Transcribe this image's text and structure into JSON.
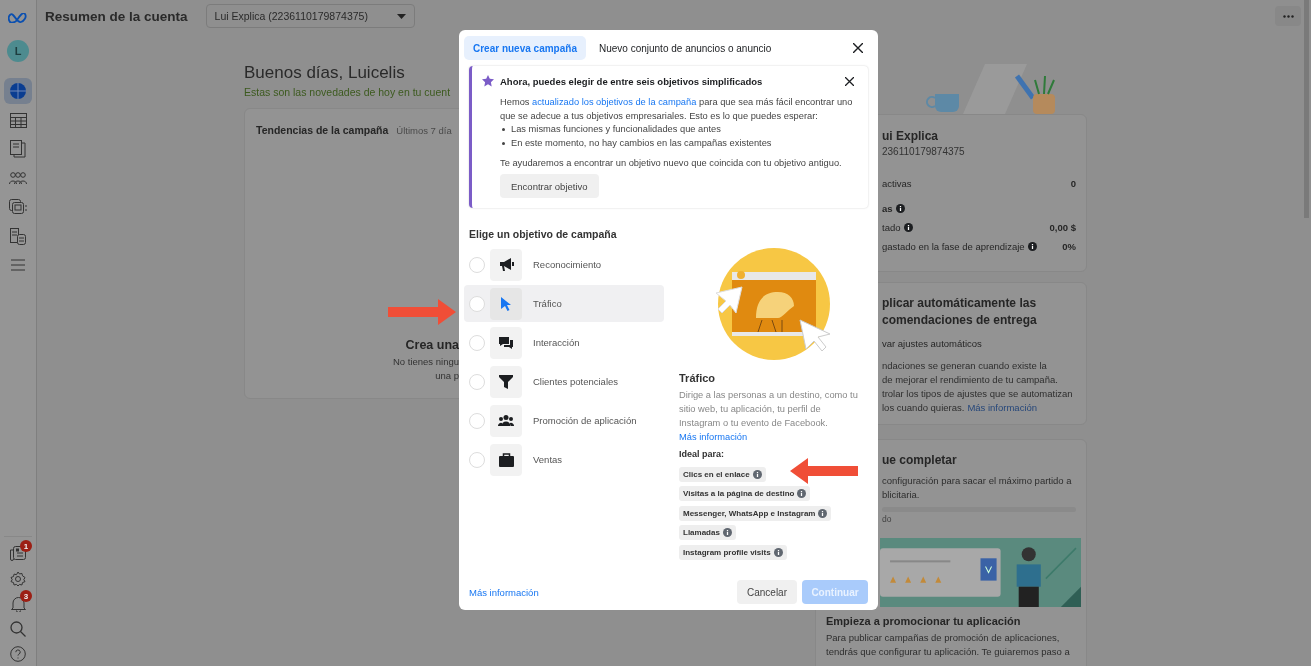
{
  "sidebar": {
    "avatar": {
      "initial": "L"
    },
    "items": [
      {
        "kind": "overview",
        "selected": true
      },
      {
        "kind": "table",
        "selected": false
      },
      {
        "kind": "pages",
        "selected": false
      },
      {
        "kind": "audiences",
        "selected": false
      },
      {
        "kind": "catalog",
        "selected": false
      },
      {
        "kind": "billing",
        "selected": false
      },
      {
        "kind": "menu",
        "selected": false
      }
    ],
    "bottom_items": [
      {
        "kind": "news",
        "badge": "1"
      },
      {
        "kind": "settings"
      },
      {
        "kind": "notifications",
        "badge": "3"
      },
      {
        "kind": "search"
      },
      {
        "kind": "help"
      }
    ]
  },
  "top_bar": {
    "title": "Resumen de la cuenta",
    "account_select": {
      "value": "Lui Explica (2236110179874375)"
    }
  },
  "greeting": {
    "title": "Buenos días, Luicelis",
    "subtitle": "Estas son las novedades de hoy en tu cuent"
  },
  "trends_card": {
    "title": "Tendencias de la campaña",
    "period": "Últimos 7 día",
    "empty_title": "Crea una",
    "empty_lines": [
      "No tienes ningu",
      "una p"
    ]
  },
  "account_card": {
    "name": "ui Explica",
    "id": "236110179874375",
    "rows": [
      {
        "kind": "stat",
        "label": "activas",
        "value": "0",
        "info": false
      },
      {
        "kind": "heading",
        "label": "as",
        "info": true
      },
      {
        "kind": "stat",
        "label": "tado",
        "value": "0,00 $",
        "info": true
      },
      {
        "kind": "stat",
        "label": "gastado en la fase de aprendizaje",
        "value": "0%",
        "info": true
      }
    ]
  },
  "recommendations_card": {
    "title_lines": [
      "plicar automáticamente las",
      "comendaciones de entrega"
    ],
    "toggle_label": "var ajustes automáticos",
    "text_lines": [
      "ndaciones se generan cuando existe la",
      "de mejorar el rendimiento de tu campaña.",
      "trolar los tipos de ajustes que se automatizan",
      "los cuando quieras."
    ],
    "link": "Más información"
  },
  "setup_card": {
    "title": "ue completar",
    "text_lines": [
      "configuración para sacar el máximo partido a",
      "blicitaria."
    ],
    "progress": {
      "label": "do"
    },
    "promo": {
      "title": "Empieza a promocionar tu aplicación",
      "text_lines": [
        "Para publicar campañas de promoción de aplicaciones,",
        "tendrás que configurar tu aplicación. Te guiaremos paso a"
      ]
    }
  },
  "modal": {
    "tabs": [
      {
        "label": "Crear nueva campaña",
        "selected": true
      },
      {
        "label": "Nuevo conjunto de anuncios o anuncio",
        "selected": false
      }
    ],
    "notice": {
      "title": "Ahora, puedes elegir de entre seis objetivos simplificados",
      "text_before": "Hemos",
      "link": "actualizado los objetivos de la campaña",
      "text_after": "para que sea más fácil encontrar uno que se adecue a tus objetivos empresariales. Esto es lo que puedes esperar:",
      "bullets": [
        "Las mismas funciones y funcionalidades que antes",
        "En este momento, no hay cambios en las campañas existentes"
      ],
      "footer_text": "Te ayudaremos a encontrar un objetivo nuevo que coincida con tu objetivo antiguo.",
      "button": "Encontrar objetivo"
    },
    "heading": "Elige un objetivo de campaña",
    "objectives": [
      {
        "kind": "megaphone",
        "label": "Reconocimiento",
        "selected": false
      },
      {
        "kind": "cursor",
        "label": "Tráfico",
        "selected": true
      },
      {
        "kind": "chat",
        "label": "Interacción",
        "selected": false
      },
      {
        "kind": "funnel",
        "label": "Clientes potenciales",
        "selected": false
      },
      {
        "kind": "people",
        "label": "Promoción de aplicación",
        "selected": false
      },
      {
        "kind": "bag",
        "label": "Ventas",
        "selected": false
      }
    ],
    "detail": {
      "title": "Tráfico",
      "description": "Dirige a las personas a un destino, como tu sitio web, tu aplicación, tu perfil de Instagram o tu evento de Facebook.",
      "link": "Más información",
      "ideal_label": "Ideal para:",
      "ideal_for": [
        "Clics en el enlace",
        "Visitas a la página de destino",
        "Messenger, WhatsApp e Instagram",
        "Llamadas",
        "Instagram profile visits"
      ]
    },
    "footer": {
      "link": "Más información",
      "cancel": "Cancelar",
      "continue": {
        "label": "Continuar",
        "disabled": true
      }
    }
  },
  "annotations": [
    {
      "kind": "right-arrow"
    },
    {
      "kind": "left-arrow"
    }
  ]
}
